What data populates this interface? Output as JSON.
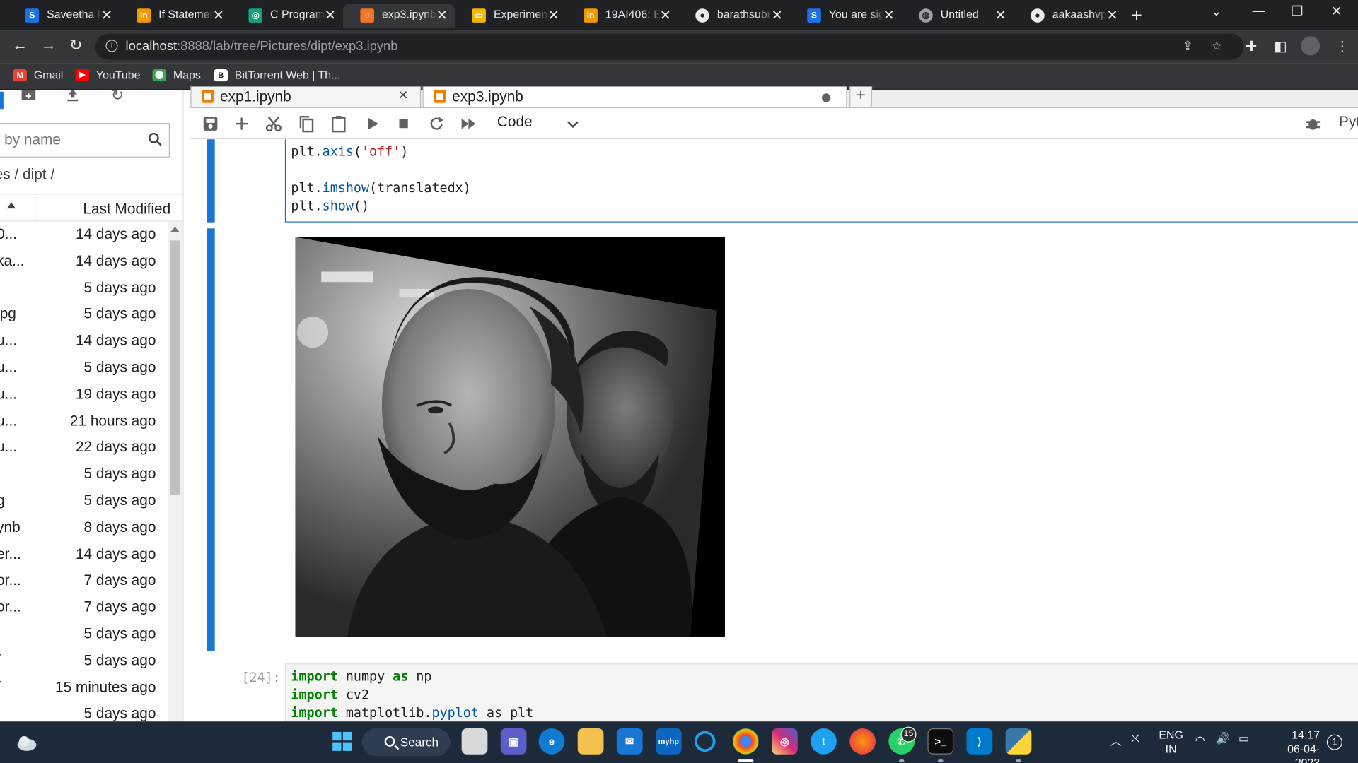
{
  "browser": {
    "tabs": [
      {
        "title": "Saveetha In",
        "favicon": "S",
        "color": "#1a73e8",
        "active": false
      },
      {
        "title": "If Statemen",
        "favicon": "in",
        "color": "#f29900",
        "active": false
      },
      {
        "title": "C Program",
        "favicon": "◎",
        "color": "#10a37f",
        "active": false
      },
      {
        "title": "exp3.ipynb",
        "favicon": "◌",
        "color": "#f37626",
        "active": true
      },
      {
        "title": "Experiment",
        "favicon": "▭",
        "color": "#f4b400",
        "active": false
      },
      {
        "title": "19AI406: Ex",
        "favicon": "in",
        "color": "#f29900",
        "active": false
      },
      {
        "title": "barathsubra",
        "favicon": "●",
        "color": "#e8eaed",
        "active": false
      },
      {
        "title": "You are sign",
        "favicon": "S",
        "color": "#1a73e8",
        "active": false
      },
      {
        "title": "Untitled",
        "favicon": "◍",
        "color": "#9aa0a6",
        "active": false
      },
      {
        "title": "aakaashvp/",
        "favicon": "●",
        "color": "#e8eaed",
        "active": false
      }
    ],
    "url_host": "localhost",
    "url_rest": ":8888/lab/tree/Pictures/dipt/exp3.ipynb",
    "bookmarks": [
      {
        "label": "Gmail",
        "icon": "M",
        "color": "#ea4335"
      },
      {
        "label": "YouTube",
        "icon": "▶",
        "color": "#ff0000"
      },
      {
        "label": "Maps",
        "icon": "⬤",
        "color": "#34a853"
      },
      {
        "label": "BitTorrent Web | Th...",
        "icon": "B",
        "color": "#202124"
      }
    ]
  },
  "filebrowser": {
    "filter_placeholder": "by name",
    "breadcrumb": "es / dipt /",
    "column_modified": "Last Modified",
    "rows": [
      {
        "name": "0...",
        "modified": "14 days ago"
      },
      {
        "name": "ka...",
        "modified": "14 days ago"
      },
      {
        "name": "",
        "modified": "5 days ago"
      },
      {
        "name": "jpg",
        "modified": "5 days ago"
      },
      {
        "name": "u...",
        "modified": "14 days ago"
      },
      {
        "name": "u...",
        "modified": "5 days ago"
      },
      {
        "name": "u...",
        "modified": "19 days ago"
      },
      {
        "name": "u...",
        "modified": "21 hours ago"
      },
      {
        "name": "u...",
        "modified": "22 days ago"
      },
      {
        "name": "",
        "modified": "5 days ago"
      },
      {
        "name": "g",
        "modified": "5 days ago"
      },
      {
        "name": "ynb",
        "modified": "8 days ago"
      },
      {
        "name": "er...",
        "modified": "14 days ago"
      },
      {
        "name": "or...",
        "modified": "7 days ago"
      },
      {
        "name": "or...",
        "modified": "7 days ago"
      },
      {
        "name": "",
        "modified": "5 days ago"
      },
      {
        "name": "/",
        "modified": "5 days ago"
      },
      {
        "name": "/",
        "modified": "15 minutes ago"
      },
      {
        "name": "",
        "modified": "5 days ago"
      }
    ]
  },
  "notebook": {
    "tabs": [
      {
        "label": "exp1.ipynb"
      },
      {
        "label": "exp3.ipynb"
      }
    ],
    "cell_type": "Code",
    "kernel": "Pyt",
    "cell1_lines": [
      [
        "plt.",
        "axis",
        "(",
        "'off'",
        ")"
      ],
      [],
      [
        "plt.",
        "imshow",
        "(translatedx)"
      ],
      [
        "plt.",
        "show",
        "()"
      ]
    ],
    "cell2_prompt": "[24]:",
    "cell2_lines": [
      [
        "import",
        " numpy ",
        "as",
        " np"
      ],
      [
        "import",
        " cv2",
        "",
        ""
      ],
      [
        "import",
        " matplotlib.",
        "pyplot",
        " as plt"
      ]
    ]
  },
  "taskbar": {
    "search_label": "Search",
    "lang1": "ENG",
    "lang2": "IN",
    "time": "14:17",
    "date": "06-04-2023",
    "notification_count": "1",
    "whatsapp_badge": "15"
  }
}
